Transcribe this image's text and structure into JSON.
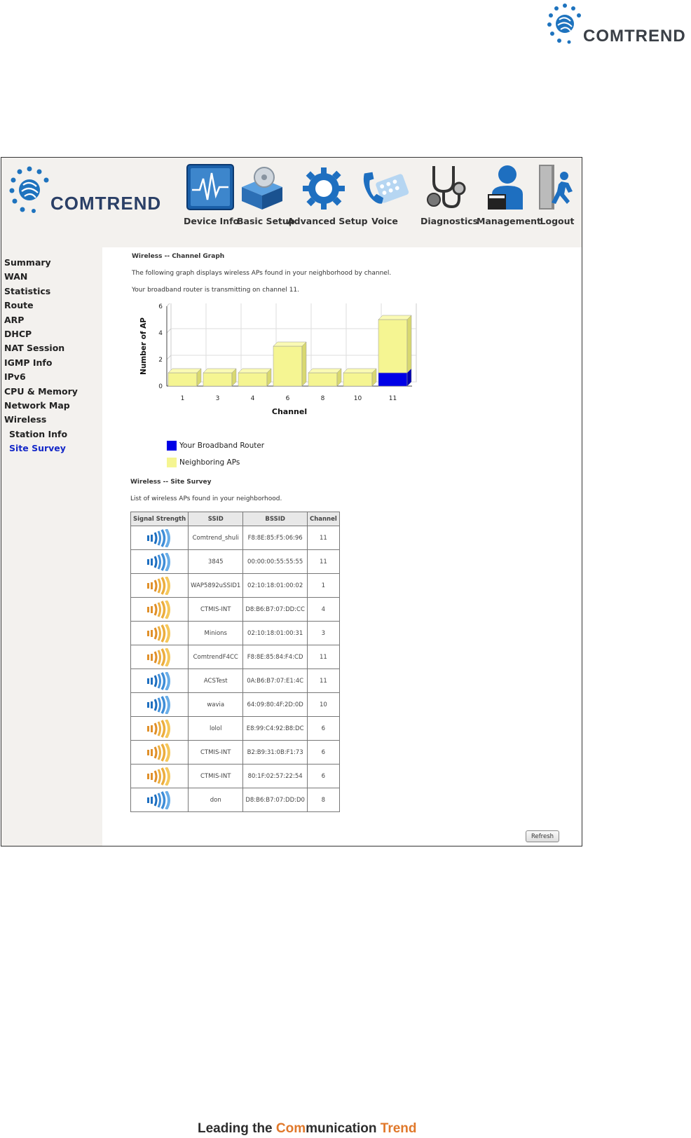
{
  "top_logo": {
    "brand": "COMTREND"
  },
  "frame_logo": {
    "brand": "COMTREND"
  },
  "nav": [
    {
      "label": "Device Info",
      "icon": "device-info-icon"
    },
    {
      "label": "Basic Setup",
      "icon": "basic-setup-icon"
    },
    {
      "label": "Advanced Setup",
      "icon": "advanced-setup-icon"
    },
    {
      "label": "Voice",
      "icon": "voice-icon"
    },
    {
      "label": "Diagnostics",
      "icon": "diagnostics-icon"
    },
    {
      "label": "Management",
      "icon": "management-icon"
    },
    {
      "label": "Logout",
      "icon": "logout-icon"
    }
  ],
  "sidebar": {
    "items": [
      {
        "label": "Summary",
        "active": false
      },
      {
        "label": "WAN",
        "active": false
      },
      {
        "label": "Statistics",
        "active": false
      },
      {
        "label": "Route",
        "active": false
      },
      {
        "label": "ARP",
        "active": false
      },
      {
        "label": "DHCP",
        "active": false
      },
      {
        "label": "NAT Session",
        "active": false
      },
      {
        "label": "IGMP Info",
        "active": false
      },
      {
        "label": "IPv6",
        "active": false
      },
      {
        "label": "CPU & Memory",
        "active": false
      },
      {
        "label": "Network Map",
        "active": false
      },
      {
        "label": "Wireless",
        "active": false
      },
      {
        "label": "Station Info",
        "active": false,
        "sub": true
      },
      {
        "label": "Site Survey",
        "active": true,
        "sub": true
      }
    ]
  },
  "channel_graph": {
    "title": "Wireless -- Channel Graph",
    "desc": "The following graph displays wireless APs found in your neighborhood by channel.",
    "transmitting": "Your broadband router is transmitting on channel 11."
  },
  "chart_data": {
    "type": "bar",
    "categories": [
      "1",
      "3",
      "4",
      "6",
      "8",
      "10",
      "11"
    ],
    "series": [
      {
        "name": "Your Broadband Router",
        "values": [
          0,
          0,
          0,
          0,
          0,
          0,
          1
        ],
        "color": "#0000e6"
      },
      {
        "name": "Neighboring APs",
        "values": [
          1,
          1,
          1,
          3,
          1,
          1,
          4
        ],
        "color": "#f5f592"
      }
    ],
    "stacked": true,
    "xlabel": "Channel",
    "ylabel": "Number of AP",
    "ylim": [
      0,
      6
    ],
    "yticks": [
      "0",
      "2",
      "4",
      "6"
    ],
    "grid": true,
    "legend_position": "bottom-left"
  },
  "site_survey": {
    "title": "Wireless -- Site Survey",
    "desc": "List of wireless APs found in your neighborhood.",
    "columns": [
      "Signal Strength",
      "SSID",
      "BSSID",
      "Channel"
    ],
    "rows": [
      {
        "signal": "blue",
        "ssid": "Comtrend_shuli",
        "bssid": "F8:8E:85:F5:06:96",
        "channel": "11"
      },
      {
        "signal": "blue",
        "ssid": "3845",
        "bssid": "00:00:00:55:55:55",
        "channel": "11"
      },
      {
        "signal": "orange",
        "ssid": "WAP5892uSSID1",
        "bssid": "02:10:18:01:00:02",
        "channel": "1"
      },
      {
        "signal": "orange",
        "ssid": "CTMIS-INT",
        "bssid": "D8:B6:B7:07:DD:CC",
        "channel": "4"
      },
      {
        "signal": "orange",
        "ssid": "Minions",
        "bssid": "02:10:18:01:00:31",
        "channel": "3"
      },
      {
        "signal": "orange",
        "ssid": "ComtrendF4CC",
        "bssid": "F8:8E:85:84:F4:CD",
        "channel": "11"
      },
      {
        "signal": "blue",
        "ssid": "ACSTest",
        "bssid": "0A:B6:B7:07:E1:4C",
        "channel": "11"
      },
      {
        "signal": "blue",
        "ssid": "wavia",
        "bssid": "64:09:80:4F:2D:0D",
        "channel": "10"
      },
      {
        "signal": "orange",
        "ssid": "lolol",
        "bssid": "E8:99:C4:92:B8:DC",
        "channel": "6"
      },
      {
        "signal": "orange",
        "ssid": "CTMIS-INT",
        "bssid": "B2:B9:31:0B:F1:73",
        "channel": "6"
      },
      {
        "signal": "orange",
        "ssid": "CTMIS-INT",
        "bssid": "80:1F:02:57:22:54",
        "channel": "6"
      },
      {
        "signal": "blue",
        "ssid": "don",
        "bssid": "D8:B6:B7:07:DD:D0",
        "channel": "8"
      }
    ],
    "refresh_label": "Refresh"
  },
  "footer": {
    "pre": "Leading the ",
    "hl1": "Com",
    "mid": "munication ",
    "hl2": "Trend"
  },
  "colors": {
    "accent_blue": "#1428c8",
    "orange": "#e0782a",
    "panel_bg": "#f3f1ee"
  }
}
